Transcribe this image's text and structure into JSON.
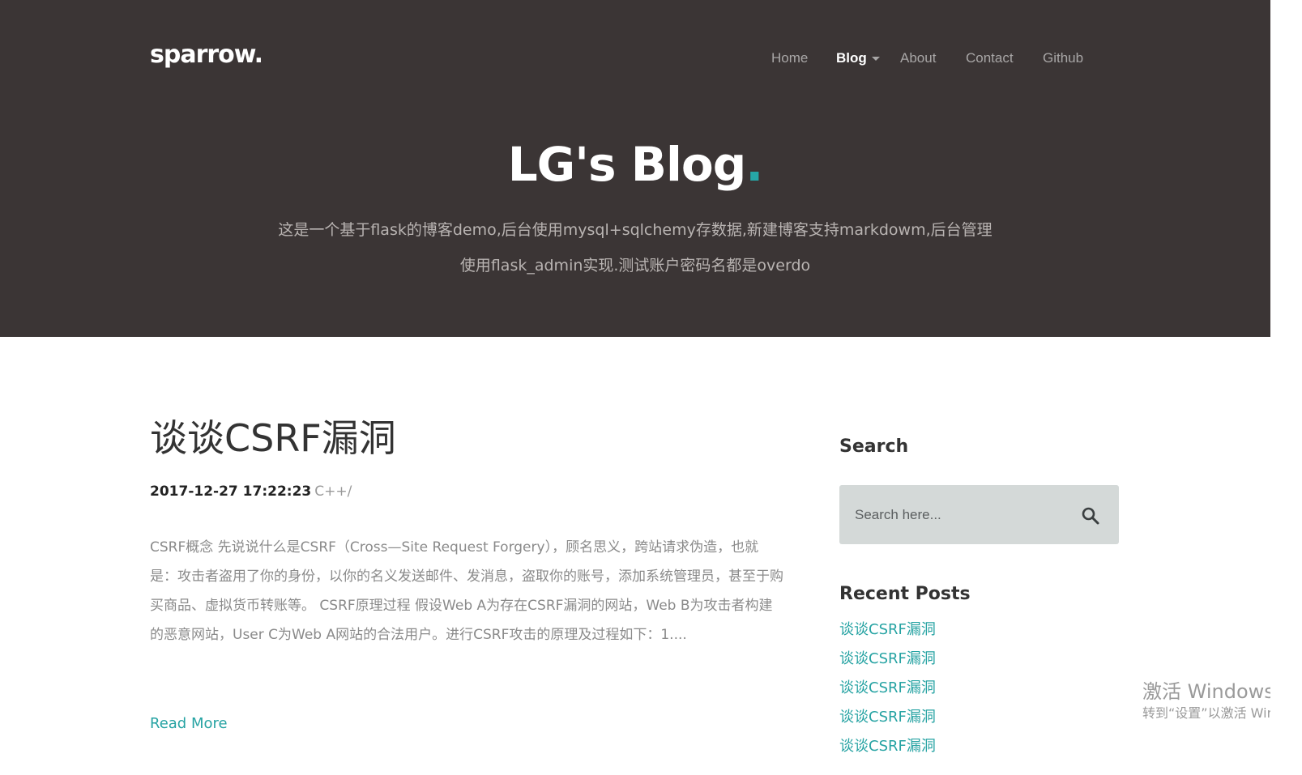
{
  "header": {
    "logo": "sparrow.",
    "nav": [
      {
        "label": "Home",
        "active": false
      },
      {
        "label": "Blog",
        "active": true,
        "dropdown": true
      },
      {
        "label": "About",
        "active": false
      },
      {
        "label": "Contact",
        "active": false
      },
      {
        "label": "Github",
        "active": false
      }
    ]
  },
  "hero": {
    "title": "LG's Blog",
    "title_dot": ".",
    "description": "这是一个基于flask的博客demo,后台使用mysql+sqlchemy存数据,新建博客支持markdowm,后台管理使用flask_admin实现.测试账户密码名都是overdo"
  },
  "post": {
    "title": "谈谈CSRF漏洞",
    "date": "2017-12-27 17:22:23",
    "category": "C++/",
    "excerpt": "CSRF概念 先说说什么是CSRF（Cross—Site Request Forgery），顾名思义，跨站请求伪造，也就是：攻击者盗用了你的身份，以你的名义发送邮件、发消息，盗取你的账号，添加系统管理员，甚至于购买商品、虚拟货币转账等。 CSRF原理过程 假设Web A为存在CSRF漏洞的网站，Web B为攻击者构建的恶意网站，User C为Web A网站的合法用户。进行CSRF攻击的原理及过程如下：1....",
    "read_more": "Read More"
  },
  "sidebar": {
    "search_heading": "Search",
    "search_placeholder": "Search here...",
    "search_icon": "search-icon",
    "recent_heading": "Recent Posts",
    "recent_posts": [
      "谈谈CSRF漏洞",
      "谈谈CSRF漏洞",
      "谈谈CSRF漏洞",
      "谈谈CSRF漏洞",
      "谈谈CSRF漏洞"
    ]
  },
  "watermark": {
    "title": "激活 Windows",
    "subtitle": "转到“设置”以激活 Windows。"
  },
  "colors": {
    "hero_bg": "#3b3535",
    "accent": "#26a3a3",
    "search_bg": "#d4d9d8"
  }
}
